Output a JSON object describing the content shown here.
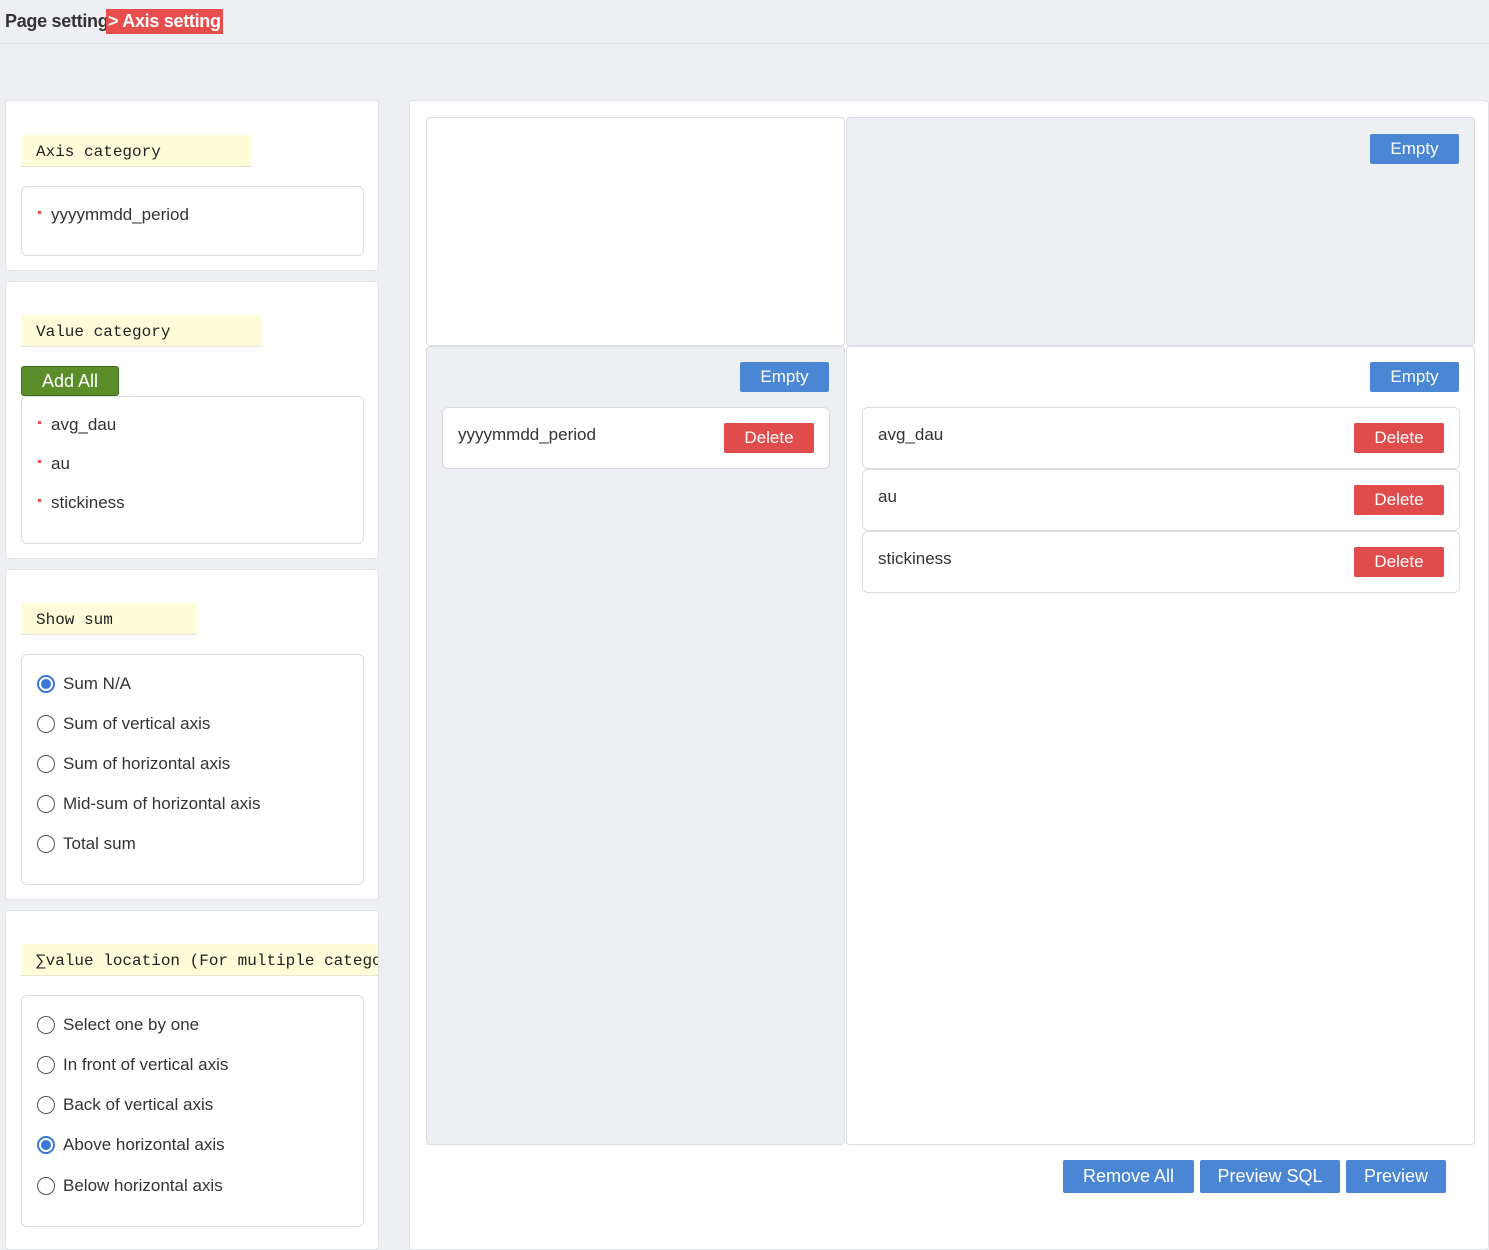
{
  "breadcrumb": {
    "page": "Page setting",
    "current": "> Axis setting"
  },
  "axis_category": {
    "title": "Axis category",
    "items": [
      "yyyymmdd_period"
    ]
  },
  "value_category": {
    "title": "Value category",
    "add_all_label": "Add All",
    "items": [
      "avg_dau",
      "au",
      "stickiness"
    ]
  },
  "show_sum": {
    "title": "Show sum",
    "options": [
      "Sum N/A",
      "Sum of vertical axis",
      "Sum of horizontal axis",
      "Mid-sum of horizontal axis",
      "Total sum"
    ],
    "selected": "Sum N/A"
  },
  "value_location": {
    "title": "∑value location (For multiple categories)",
    "options": [
      "Select one by one",
      "In front of vertical axis",
      "Back of vertical axis",
      "Above horizontal axis",
      "Below horizontal axis"
    ],
    "selected": "Above horizontal axis"
  },
  "layout_zones": {
    "top_right": {
      "empty_label": "Empty"
    },
    "left_axis": {
      "empty_label": "Empty",
      "items": [
        {
          "label": "yyyymmdd_period",
          "delete_label": "Delete"
        }
      ]
    },
    "values": {
      "empty_label": "Empty",
      "items": [
        {
          "label": "avg_dau",
          "delete_label": "Delete"
        },
        {
          "label": "au",
          "delete_label": "Delete"
        },
        {
          "label": "stickiness",
          "delete_label": "Delete"
        }
      ]
    }
  },
  "actions": {
    "remove_all": "Remove All",
    "preview_sql": "Preview SQL",
    "preview": "Preview"
  },
  "colors": {
    "accent_blue": "#4a86d4",
    "danger_red": "#e04b4b",
    "add_green": "#5b8e2a",
    "title_highlight": "#fefdd9"
  }
}
